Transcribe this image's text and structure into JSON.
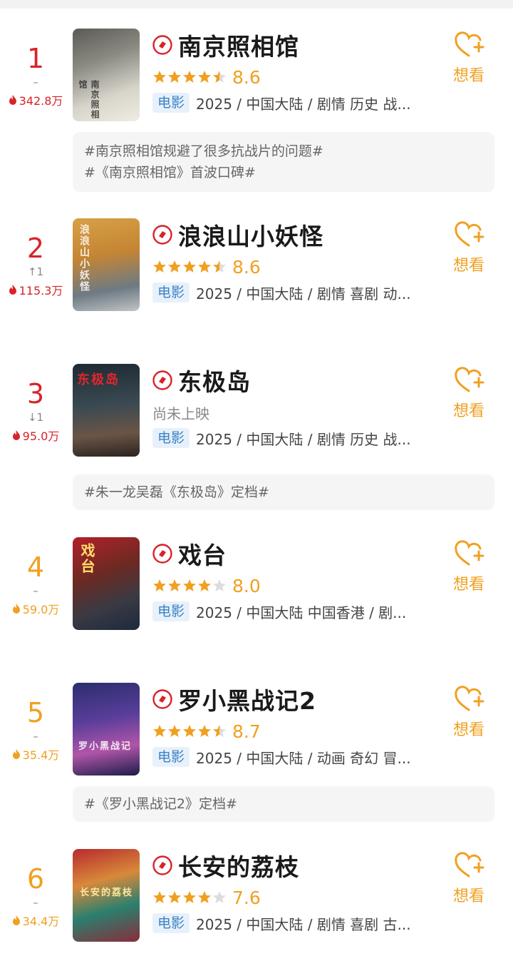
{
  "colors": {
    "red": "#d8232a",
    "orange": "#f0a020",
    "tagBlue": "#3b82c4"
  },
  "want_label": "想看",
  "items": [
    {
      "rank": "1",
      "change": "–",
      "heat": "342.8万",
      "title": "南京照相馆",
      "score": "8.6",
      "stars_value": 4.5,
      "tag": "电影",
      "meta": "2025 / 中国大陆 / 剧情 历史 战...",
      "poster_text": "南京照相馆",
      "topics": [
        "#南京照相馆规避了很多抗战片的问题#",
        "#《南京照相馆》首波口碑#"
      ]
    },
    {
      "rank": "2",
      "change": "↑1",
      "heat": "115.3万",
      "title": "浪浪山小妖怪",
      "score": "8.6",
      "stars_value": 4.5,
      "tag": "电影",
      "meta": "2025 / 中国大陆 / 剧情 喜剧 动...",
      "poster_text": "浪浪山小妖怪",
      "topics": []
    },
    {
      "rank": "3",
      "change": "↓1",
      "heat": "95.0万",
      "title": "东极岛",
      "status": "尚未上映",
      "tag": "电影",
      "meta": "2025 / 中国大陆 / 剧情 历史 战...",
      "poster_text": "东极岛",
      "topics": [
        "#朱一龙吴磊《东极岛》定档#"
      ]
    },
    {
      "rank": "4",
      "change": "–",
      "heat": "59.0万",
      "title": "戏台",
      "score": "8.0",
      "stars_value": 4,
      "tag": "电影",
      "meta": "2025 / 中国大陆 中国香港 / 剧...",
      "poster_text": "戏台",
      "topics": []
    },
    {
      "rank": "5",
      "change": "–",
      "heat": "35.4万",
      "title": "罗小黑战记2",
      "score": "8.7",
      "stars_value": 4.5,
      "tag": "电影",
      "meta": "2025 / 中国大陆 / 动画 奇幻 冒...",
      "poster_text": "罗小黑战记",
      "topics": [
        "#《罗小黑战记2》定档#"
      ]
    },
    {
      "rank": "6",
      "change": "–",
      "heat": "34.4万",
      "title": "长安的荔枝",
      "score": "7.6",
      "stars_value": 4,
      "tag": "电影",
      "meta": "2025 / 中国大陆 / 剧情 喜剧 古...",
      "poster_text": "长安的荔枝",
      "topics": []
    }
  ]
}
